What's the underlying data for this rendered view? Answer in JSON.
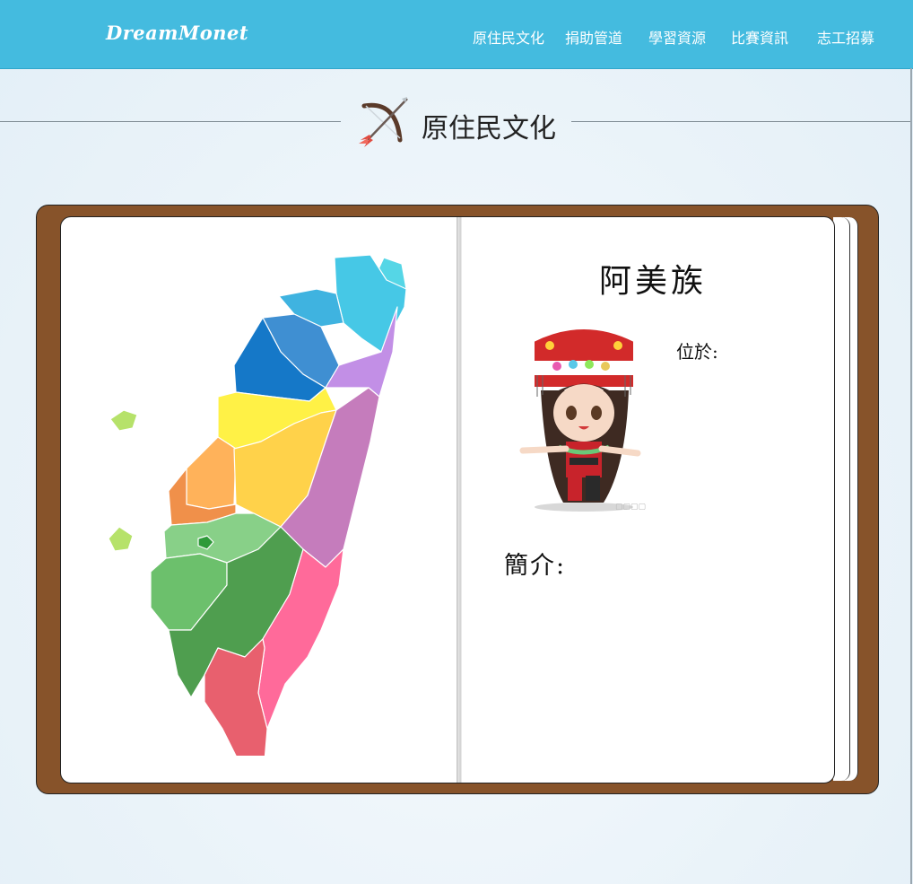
{
  "navbar": {
    "brand": "DreamMonet",
    "links": [
      "原住民文化",
      "捐助管道",
      "學習資源",
      "比賽資訊",
      "志工招募"
    ]
  },
  "header": {
    "title": "原住民文化",
    "icon": "bow-and-arrow-icon"
  },
  "book": {
    "tribe_name": "阿美族",
    "location_label": "位於:",
    "intro_label": "簡介:",
    "avatar": "amis-girl-avatar",
    "map": "taiwan-county-map"
  },
  "colors": {
    "navbar": "#44bbdf",
    "book_cover": "#87532a",
    "page": "#ffffff"
  }
}
